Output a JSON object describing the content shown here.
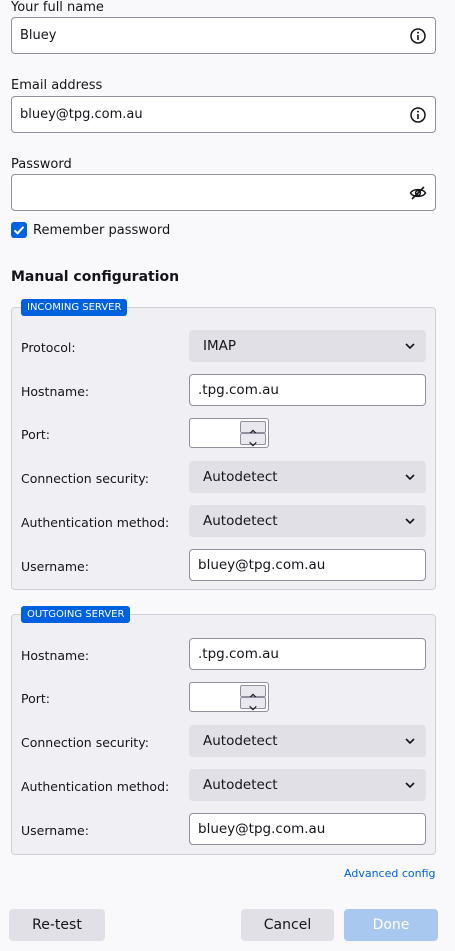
{
  "identity": {
    "name_label": "Your full name",
    "name_value": "Bluey",
    "email_label": "Email address",
    "email_value": "bluey@tpg.com.au",
    "password_label": "Password",
    "password_value": "",
    "remember_label": "Remember password",
    "remember_checked": true
  },
  "manual": {
    "title": "Manual configuration",
    "incoming": {
      "badge": "INCOMING SERVER",
      "protocol_label": "Protocol:",
      "protocol_value": "IMAP",
      "hostname_label": "Hostname:",
      "hostname_value": ".tpg.com.au",
      "port_label": "Port:",
      "port_value": "",
      "security_label": "Connection security:",
      "security_value": "Autodetect",
      "auth_label": "Authentication method:",
      "auth_value": "Autodetect",
      "username_label": "Username:",
      "username_value": "bluey@tpg.com.au"
    },
    "outgoing": {
      "badge": "OUTGOING SERVER",
      "hostname_label": "Hostname:",
      "hostname_value": ".tpg.com.au",
      "port_label": "Port:",
      "port_value": "",
      "security_label": "Connection security:",
      "security_value": "Autodetect",
      "auth_label": "Authentication method:",
      "auth_value": "Autodetect",
      "username_label": "Username:",
      "username_value": "bluey@tpg.com.au"
    },
    "advanced_link": "Advanced config"
  },
  "footer": {
    "retest": "Re-test",
    "cancel": "Cancel",
    "done": "Done"
  },
  "colors": {
    "accent": "#0061e0",
    "done_disabled": "#a8c8f0"
  },
  "icons": {
    "info": "info-icon",
    "eye_slash": "eye-slash-icon",
    "chevron": "chevron-down-icon",
    "check": "checkmark-icon"
  }
}
